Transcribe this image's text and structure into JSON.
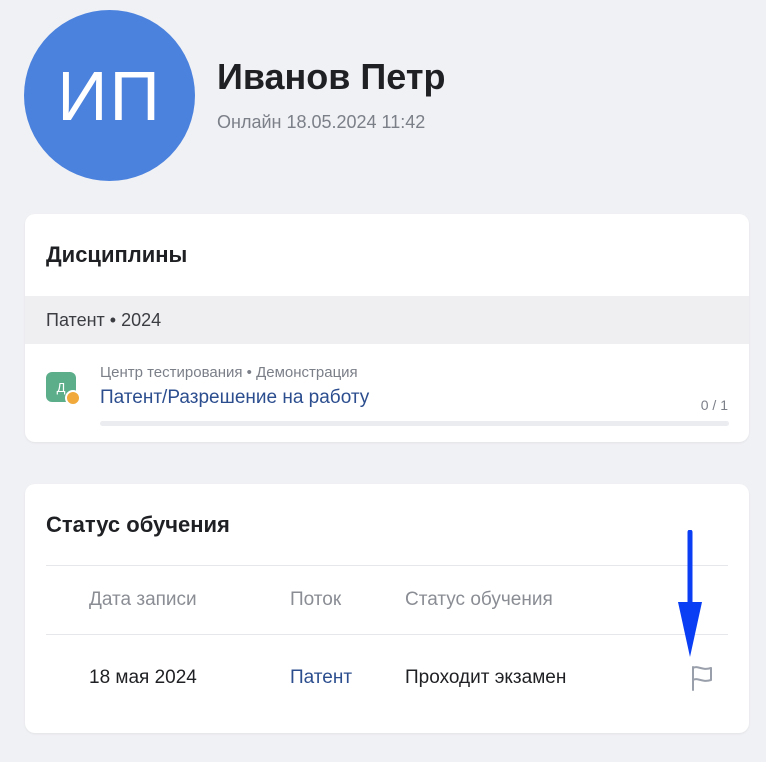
{
  "profile": {
    "initials": "ИП",
    "name": "Иванов Петр",
    "status": "Онлайн 18.05.2024 11:42",
    "avatar_color": "#4b82de"
  },
  "disciplines": {
    "title": "Дисциплины",
    "group": "Патент • 2024",
    "course": {
      "icon_letter": "Д",
      "meta": "Центр тестирования • Демонстрация",
      "name": "Патент/Разрешение на работу",
      "progress": "0 / 1",
      "progress_fraction": 0
    }
  },
  "status": {
    "title": "Статус обучения",
    "columns": [
      "Дата записи",
      "Поток",
      "Статус обучения"
    ],
    "rows": [
      {
        "date": "18 мая 2024",
        "stream": "Патент",
        "state": "Проходит экзамен",
        "action_icon": "flag-icon"
      }
    ]
  },
  "colors": {
    "accent": "#4b82de",
    "link": "#2c4e8f",
    "annotation_arrow": "#0a3ef5"
  }
}
